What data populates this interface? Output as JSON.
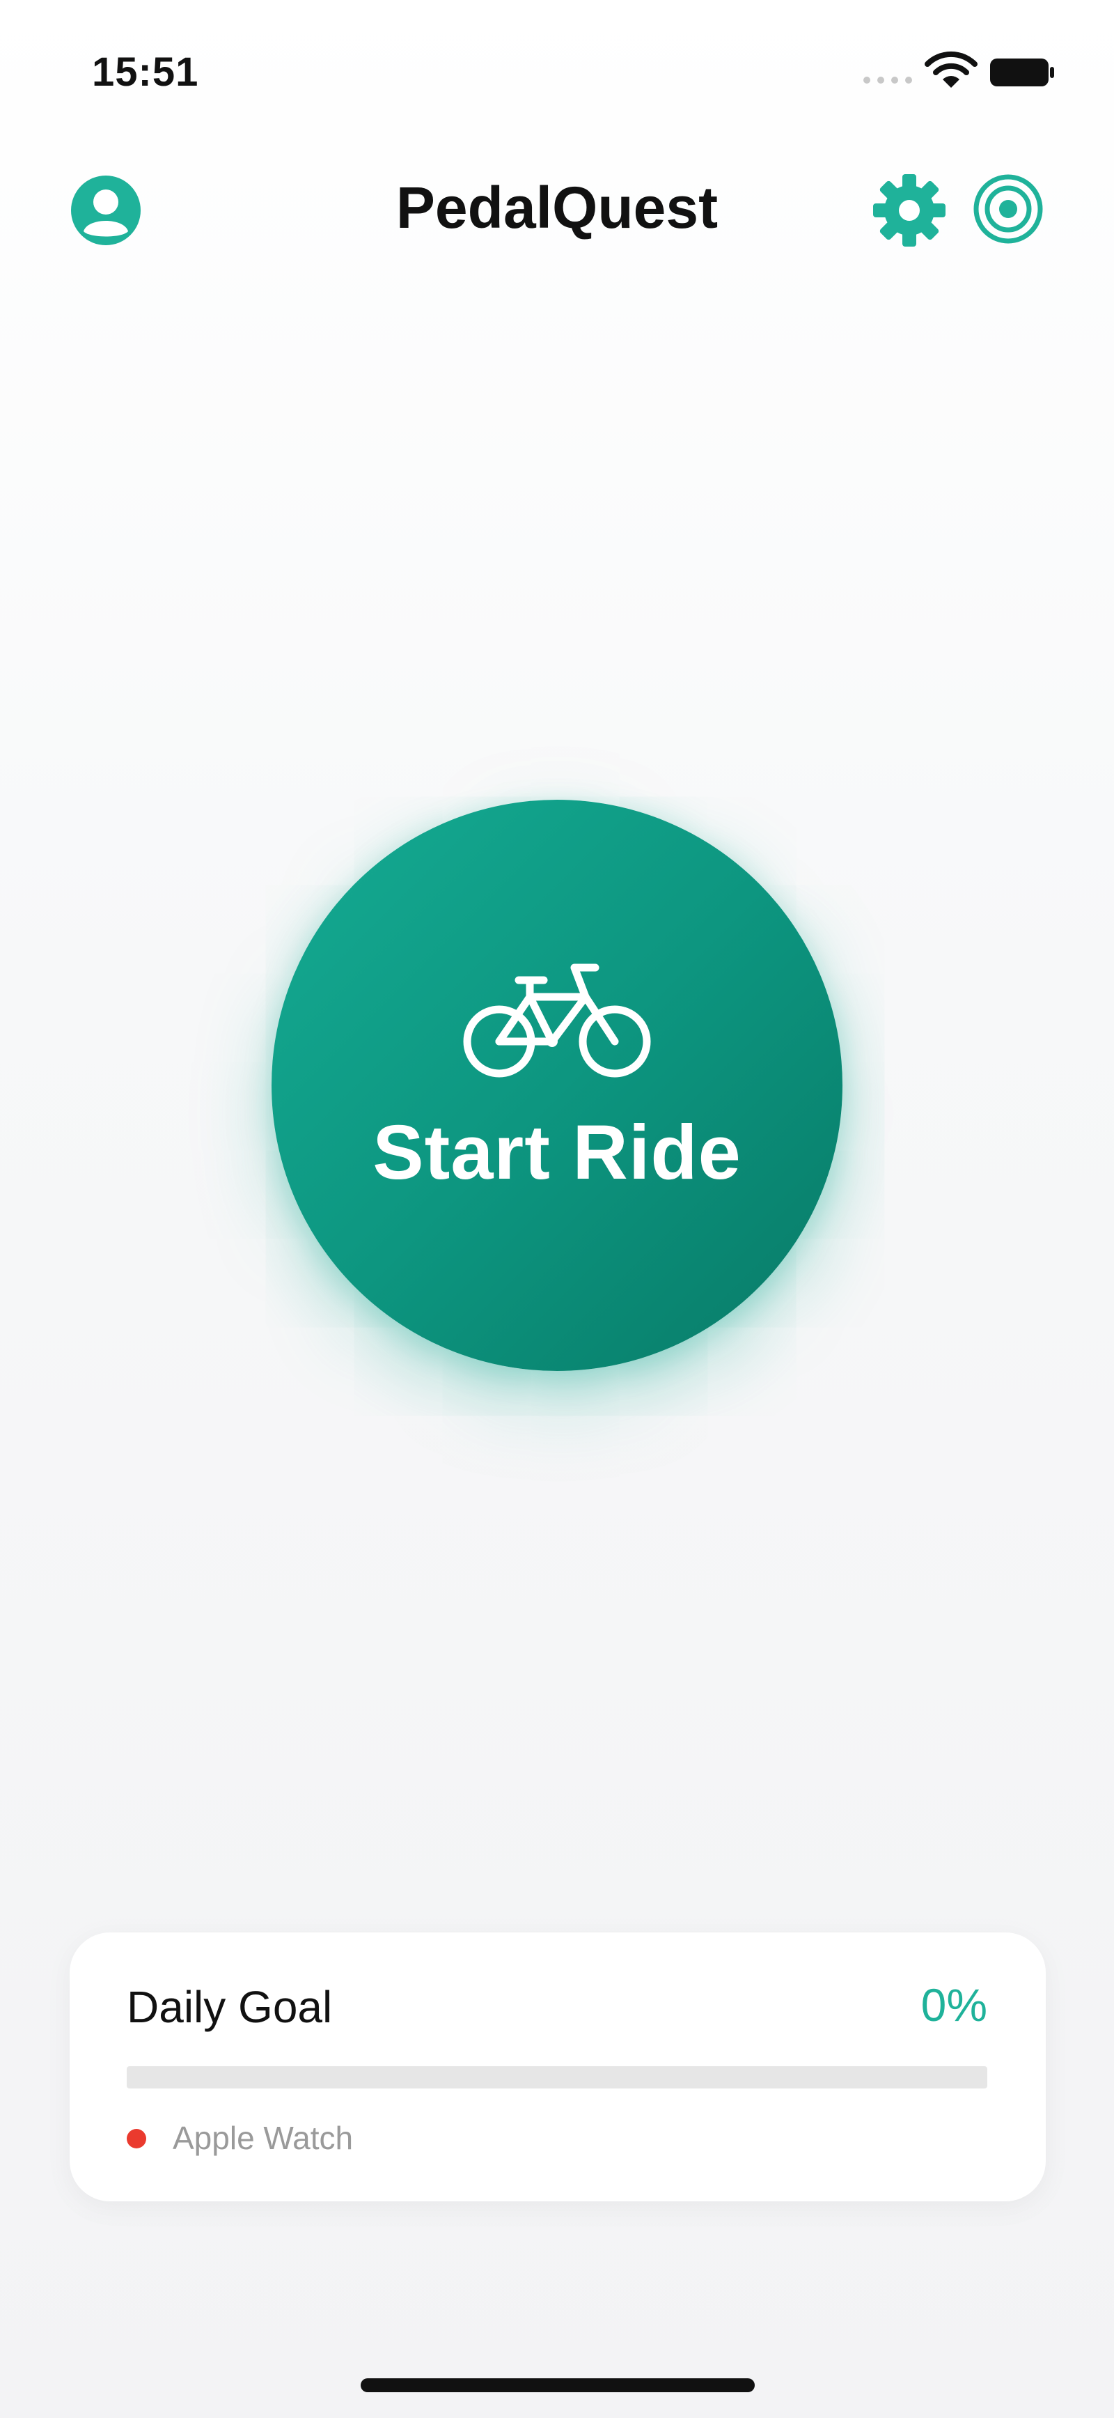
{
  "status_bar": {
    "time": "15:51",
    "icons": [
      "signal-icon",
      "wifi-icon",
      "battery-icon"
    ]
  },
  "header": {
    "title": "PedalQuest",
    "left_icon": "profile-icon",
    "right_icons": [
      "gear-icon",
      "target-icon"
    ]
  },
  "main": {
    "start_button": {
      "icon": "bike-icon",
      "label": "Start Ride"
    }
  },
  "goal_card": {
    "title": "Daily Goal",
    "percent_label": "0%",
    "progress_fraction": 0,
    "device_label": "Apple Watch",
    "device_status_color": "#ea3a2e"
  },
  "colors": {
    "accent": "#1fb29a",
    "button_gradient_start": "#15ab93",
    "button_gradient_end": "#087a67",
    "track": "#e6e6e6"
  }
}
